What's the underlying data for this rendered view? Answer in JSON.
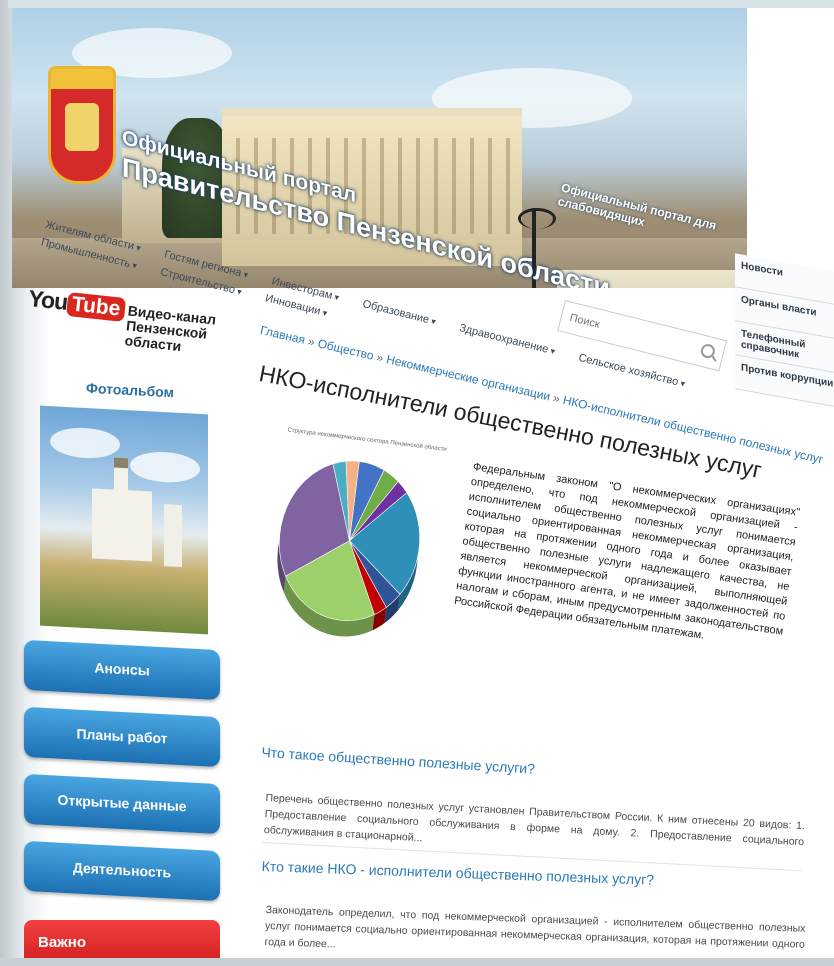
{
  "banner": {
    "title_line1": "Официальный портал",
    "title_line2": "Правительство Пензенской области",
    "top_link": "Официальный портал для слабовидящих",
    "search_placeholder": "Поиск"
  },
  "nav": {
    "items": [
      {
        "label": "Жителям области"
      },
      {
        "label": "Гостям региона"
      },
      {
        "label": "Инвесторам"
      },
      {
        "label": "Образование"
      },
      {
        "label": "Здравоохранение"
      },
      {
        "label": "Сельское хозяйство"
      },
      {
        "label": "Промышленность"
      },
      {
        "label": "Строительство"
      },
      {
        "label": "Инновации"
      }
    ]
  },
  "right_menu": {
    "items": [
      "Новости",
      "Органы власти",
      "Телефонный справочник",
      "Против коррупции"
    ]
  },
  "sidebar": {
    "youtube_you": "You",
    "youtube_tube": "Tube",
    "youtube_caption": "Видео-канал Пензенской области",
    "photo_album": "Фотоальбом",
    "buttons": [
      "Анонсы",
      "Планы работ",
      "Открытые данные",
      "Деятельность"
    ],
    "important": "Важно"
  },
  "breadcrumb": {
    "items": [
      "Главная",
      "Общество",
      "Некоммерческие организации",
      "НКО-исполнители общественно полезных услуг"
    ],
    "separator": "»"
  },
  "page": {
    "title": "НКО-исполнители общественно полезных услуг",
    "chart_caption": "Структура некоммерческого сектора Пензенской области",
    "intro": "Федеральным законом \"О некоммерческих организациях\" определено, что под некоммерческой организацией - исполнителем общественно полезных услуг понимается социально ориентированная некоммерческая организация, которая на протяжении одного года и более оказывает общественно полезные услуги надлежащего качества, не является некоммерческой организацией, выполняющей функции иностранного агента, и не имеет задолженностей по налогам и сборам, иным предусмотренным законодательством Российской Федерации обязательным платежам."
  },
  "faq": [
    {
      "question": "Что такое общественно полезные услуги?",
      "answer": "Перечень общественно полезных услуг установлен Правительством России. К ним отнесены 20 видов: 1. Предоставление социального обслуживания в форме на дому. 2. Предоставление социального обслуживания в стационарной..."
    },
    {
      "question": "Кто такие НКО - исполнители общественно полезных услуг?",
      "answer": "Законодатель определил, что под некоммерческой организацией - исполнителем общественно полезных услуг понимается социально ориентированная некоммерческая организация, которая на протяжении одного года и более..."
    }
  ],
  "chart_data": {
    "type": "pie",
    "title": "Структура некоммерческого сектора Пензенской области",
    "slices": [
      {
        "value": 6,
        "color": "#4472c4"
      },
      {
        "value": 4,
        "color": "#70ad47"
      },
      {
        "value": 3,
        "color": "#7030a0"
      },
      {
        "value": 22,
        "color": "#2e8fb8"
      },
      {
        "value": 4,
        "color": "#2f5597"
      },
      {
        "value": 3,
        "color": "#c00000"
      },
      {
        "value": 24,
        "color": "#9bd06a"
      },
      {
        "value": 28,
        "color": "#8064a2"
      },
      {
        "value": 3,
        "color": "#4bacc6"
      },
      {
        "value": 3,
        "color": "#f4b183"
      }
    ]
  },
  "colors": {
    "link": "#2b7ab6",
    "button": "#2a86c8",
    "important": "#e32626"
  }
}
